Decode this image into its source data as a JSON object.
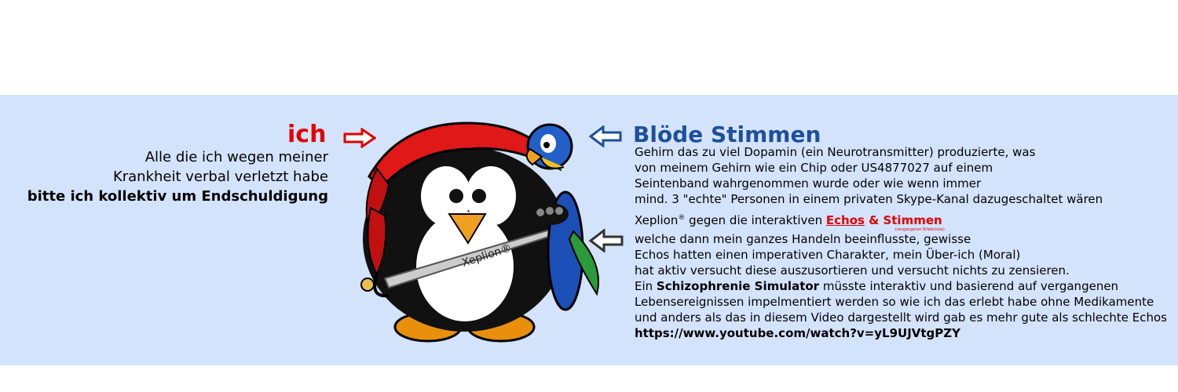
{
  "left": {
    "title": "ich",
    "line1": "Alle die ich wegen meiner",
    "line2": "Krankheit verbal verletzt habe",
    "line3": "bitte ich kollektiv um Endschuldigung"
  },
  "right": {
    "title": "Blöde Stimmen",
    "p1": [
      "Gehirn das zu viel Dopamin (ein Neurotransmitter) produzierte, was",
      "von meinem Gehirn wie ein Chip oder US4877027 auf einem",
      "Seintenband wahrgenommen wurde oder wie wenn immer",
      "mind. 3 \"echte\" Personen in einem privaten Skype-Kanal dazugeschaltet wären"
    ],
    "xeplion": "Xeplion",
    "reg": "®",
    "p2_intro": " gegen die interaktiven ",
    "echos": "Echos",
    "stimmen": " & Stimmen",
    "tiny_note": "(vergangener Erlebnisse)",
    "p2_lines": [
      "welche dann mein ganzes Handeln beeinflusste, gewisse",
      "Echos hatten einen imperativen Charakter, mein Über-ich (Moral)",
      "hat aktiv versucht diese auszusortieren und versucht nichts zu zensieren."
    ],
    "ein": "Ein ",
    "simulator": "Schizophrenie Simulator",
    "simulator_rest": " müsste interaktiv und basierend auf vergangenen",
    "p3_lines": [
      "Lebensereignissen impelmentiert werden so wie ich das erlebt habe ohne Medikamente",
      "und anders als das in diesem Video dargestellt wird gab es mehr gute als schlechte Echos"
    ],
    "url": "https://www.youtube.com/watch?v=yL9UJVtgPZY"
  },
  "penguin": {
    "sword_label": "Xeplion®"
  },
  "colors": {
    "band": "#d4e3fc",
    "red": "#e00000",
    "blue": "#1d4f9c"
  }
}
